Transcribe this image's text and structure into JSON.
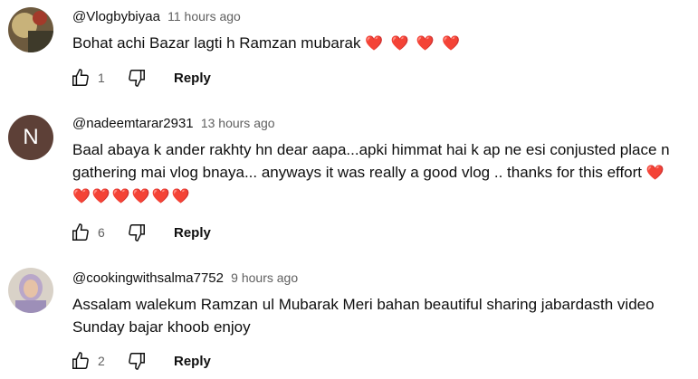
{
  "comments": [
    {
      "handle": "@Vlogbybiyaa",
      "time": "11 hours ago",
      "text": "Bohat achi Bazar lagti h Ramzan mubarak",
      "hearts": "❤️ ❤️ ❤️ ❤️",
      "likes": "1",
      "reply_label": "Reply"
    },
    {
      "avatar_letter": "N",
      "handle": "@nadeemtarar2931",
      "time": "13 hours ago",
      "text": "Baal abaya k ander rakhty hn dear aapa...apki himmat hai k ap ne esi conjusted place n gathering mai vlog bnaya... anyways it was really a good vlog .. thanks for this effort",
      "hearts": "❤️",
      "hearts2": "❤️❤️❤️❤️❤️❤️",
      "likes": "6",
      "reply_label": "Reply"
    },
    {
      "handle": "@cookingwithsalma7752",
      "time": "9 hours ago",
      "text": "Assalam walekum Ramzan ul Mubarak Meri bahan beautiful sharing jabardasth video Sunday bajar khoob enjoy",
      "likes": "2",
      "reply_label": "Reply"
    }
  ],
  "colors": {
    "heart": "#e62117",
    "avatar_n_bg": "#5d4037",
    "meta_gray": "#606060"
  },
  "icons": [
    "thumb-up-icon",
    "thumb-down-icon"
  ]
}
